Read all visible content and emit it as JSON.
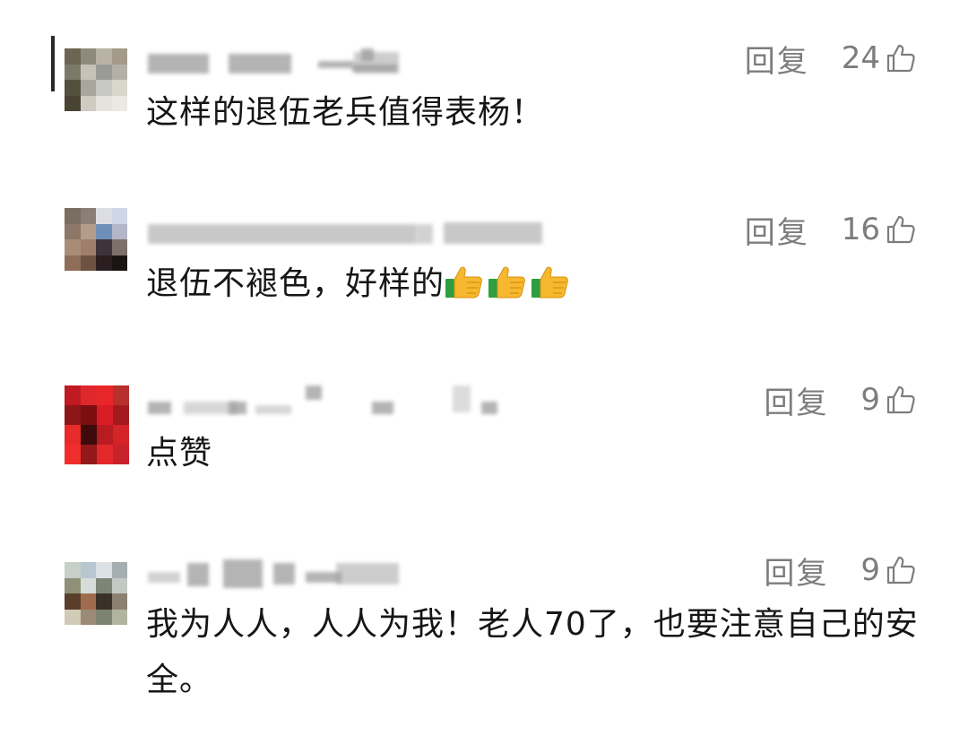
{
  "comments": [
    {
      "reply_label": "回复",
      "likes": "24",
      "text": "这样的退伍老兵值得表杨！"
    },
    {
      "reply_label": "回复",
      "likes": "16",
      "text": "退伍不褪色，好样的",
      "emoji": [
        "thumbs-up-emoji",
        "thumbs-up-emoji",
        "thumbs-up-emoji"
      ]
    },
    {
      "reply_label": "回复",
      "likes": "9",
      "text": "点赞"
    },
    {
      "reply_label": "回复",
      "likes": "9",
      "text": "我为人人，人人为我！老人70了，也要注意自己的安全。"
    }
  ],
  "icons": {
    "like": "thumbs-up-outline-icon"
  },
  "colors": {
    "meta_gray": "#7d7d7d",
    "text": "#161616",
    "emoji_yellow": "#f5b82e",
    "emoji_green": "#2e9e3e"
  }
}
